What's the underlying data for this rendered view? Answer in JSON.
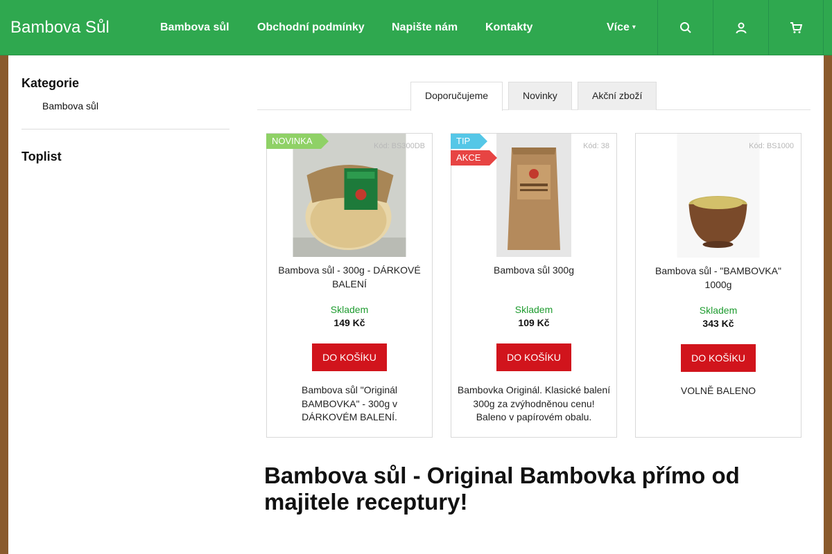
{
  "header": {
    "brand": "Bambova Sůl",
    "nav": [
      "Bambova sůl",
      "Obchodní podmínky",
      "Napište nám",
      "Kontakty"
    ],
    "more": "Více",
    "icons": [
      "search-icon",
      "user-icon",
      "cart-icon"
    ]
  },
  "sidebar": {
    "categories_title": "Kategorie",
    "categories": [
      "Bambova sůl"
    ],
    "toplist_title": "Toplist"
  },
  "tabs": [
    "Doporučujeme",
    "Novinky",
    "Akční zboží"
  ],
  "products": [
    {
      "flags": [
        "NOVINKA"
      ],
      "code": "Kód: BS300DB",
      "name": "Bambova sůl - 300g - DÁRKOVÉ BALENÍ",
      "stock": "Skladem",
      "price": "149 Kč",
      "button": "DO KOŠÍKU",
      "description": "Bambova sůl \"Originál BAMBOVKA\" - 300g v DÁRKOVÉM BALENÍ."
    },
    {
      "flags": [
        "TIP",
        "AKCE"
      ],
      "code": "Kód: 38",
      "name": "Bambova sůl 300g",
      "stock": "Skladem",
      "price": "109 Kč",
      "button": "DO KOŠÍKU",
      "description": "Bambovka Originál. Klasické balení 300g za zvýhodněnou cenu! Baleno v papírovém obalu."
    },
    {
      "flags": [],
      "code": "Kód: BS1000",
      "name": "Bambova sůl - \"BAMBOVKA\" 1000g",
      "stock": "Skladem",
      "price": "343 Kč",
      "button": "DO KOŠÍKU",
      "description": "VOLNĚ BALENO"
    }
  ],
  "headline": "Bambova sůl - Original Bambovka přímo od majitele receptury!",
  "colors": {
    "header": "#2fa84f",
    "buy_button": "#d1141c",
    "stock": "#1e9b2f",
    "flag_new": "#8fd166",
    "flag_tip": "#55c7e7",
    "flag_sale": "#e74443"
  }
}
